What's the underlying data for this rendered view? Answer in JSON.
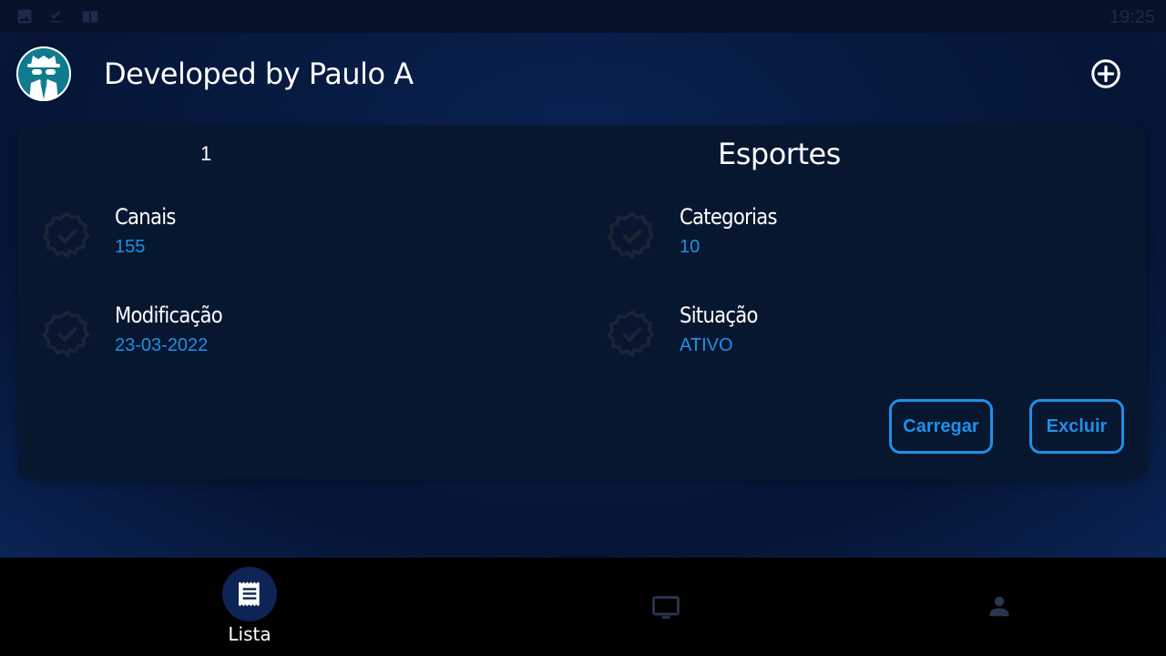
{
  "status_bar": {
    "time": "19:25",
    "icons": [
      "image-icon",
      "download-done-icon",
      "book-icon"
    ]
  },
  "app_bar": {
    "title": "Developed by Paulo A",
    "avatar_icon": "spy-avatar-icon",
    "add_icon": "add-circle-icon"
  },
  "list_card": {
    "number": "1",
    "name": "Esportes",
    "fields": [
      {
        "label": "Canais",
        "value": "155"
      },
      {
        "label": "Categorias",
        "value": "10"
      },
      {
        "label": "Modificação",
        "value": "23-03-2022"
      },
      {
        "label": "Situação",
        "value": "ATIVO"
      }
    ],
    "load_label": "Carregar",
    "delete_label": "Excluir"
  },
  "bottom_nav": {
    "items": [
      {
        "label": "Lista",
        "icon": "receipt-list-icon",
        "active": true
      },
      {
        "label": "",
        "icon": "tv-icon",
        "active": false
      },
      {
        "label": "",
        "icon": "person-icon",
        "active": false
      }
    ]
  },
  "colors": {
    "accent": "#1e90e8",
    "card_bg": "#071730",
    "nav_bg": "#000000",
    "nav_active_pill": "#0d2454",
    "badge": "#1a2536"
  }
}
